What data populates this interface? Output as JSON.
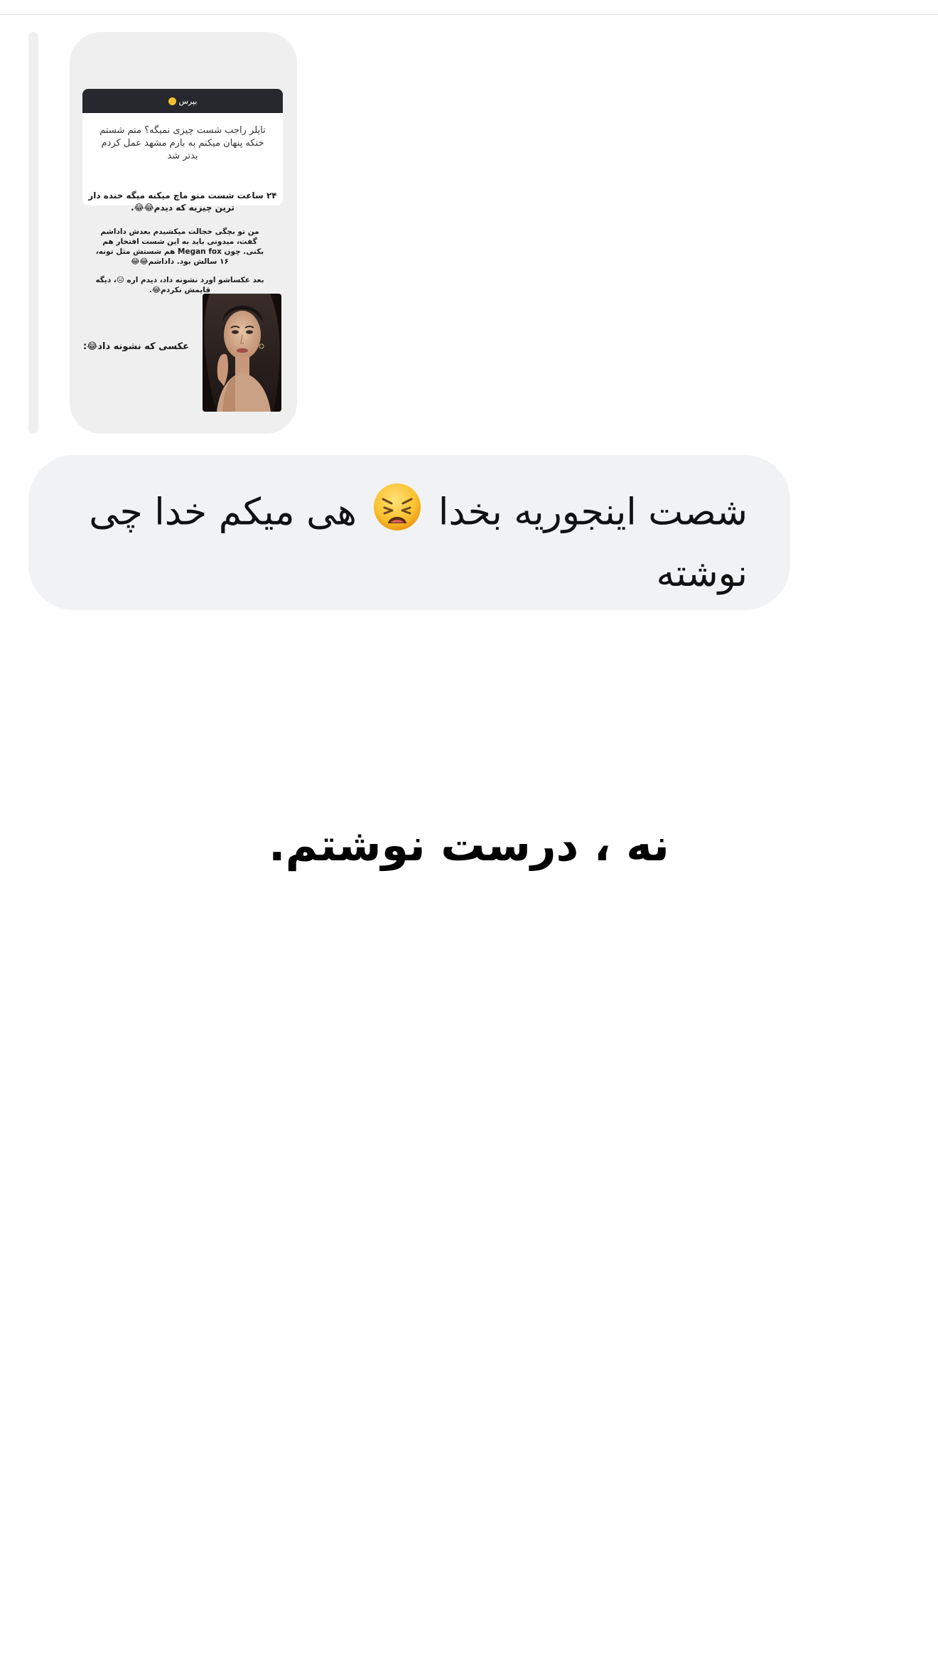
{
  "story": {
    "question_header": "بپرس",
    "question_text": "تایلر راجب شست چیزی نمیگه؟ منم شستم خنکه پنهان میکنم به بارم مشهد عمل کردم بدتر شد",
    "line_1": "۲۴ ساعت شست منو ماچ میکنه میگه خنده دار ترین چیزیه که دیدم😂😂.",
    "line_2": "من تو بچگی خجالت میکشیدم بعدش داداشم گفت، میدونی باید به این شست افتخار هم بکنی. چون Megan fox هم شستش مثل تونه، ۱۶ سالش بود. داداشم😂😂",
    "line_3": "بعد عکساشو اورد نشونه داد، دیدم اره 😑، دیگه قایمش نکردم😂.",
    "caption": "عکسی که نشونه داد😂:",
    "photo_icon": "portrait-photo"
  },
  "message": {
    "text_before_emoji": "شصت اینجوریه بخدا",
    "emoji": "weary-face-emoji",
    "text_after_emoji": "هی میکم خدا چی نوشته"
  },
  "caption": {
    "text": "نه ، درست نوشتم."
  },
  "colors": {
    "bubble": "#f1f2f4",
    "story_bg": "#efefef",
    "story_header": "#26282d",
    "text": "#111111"
  }
}
